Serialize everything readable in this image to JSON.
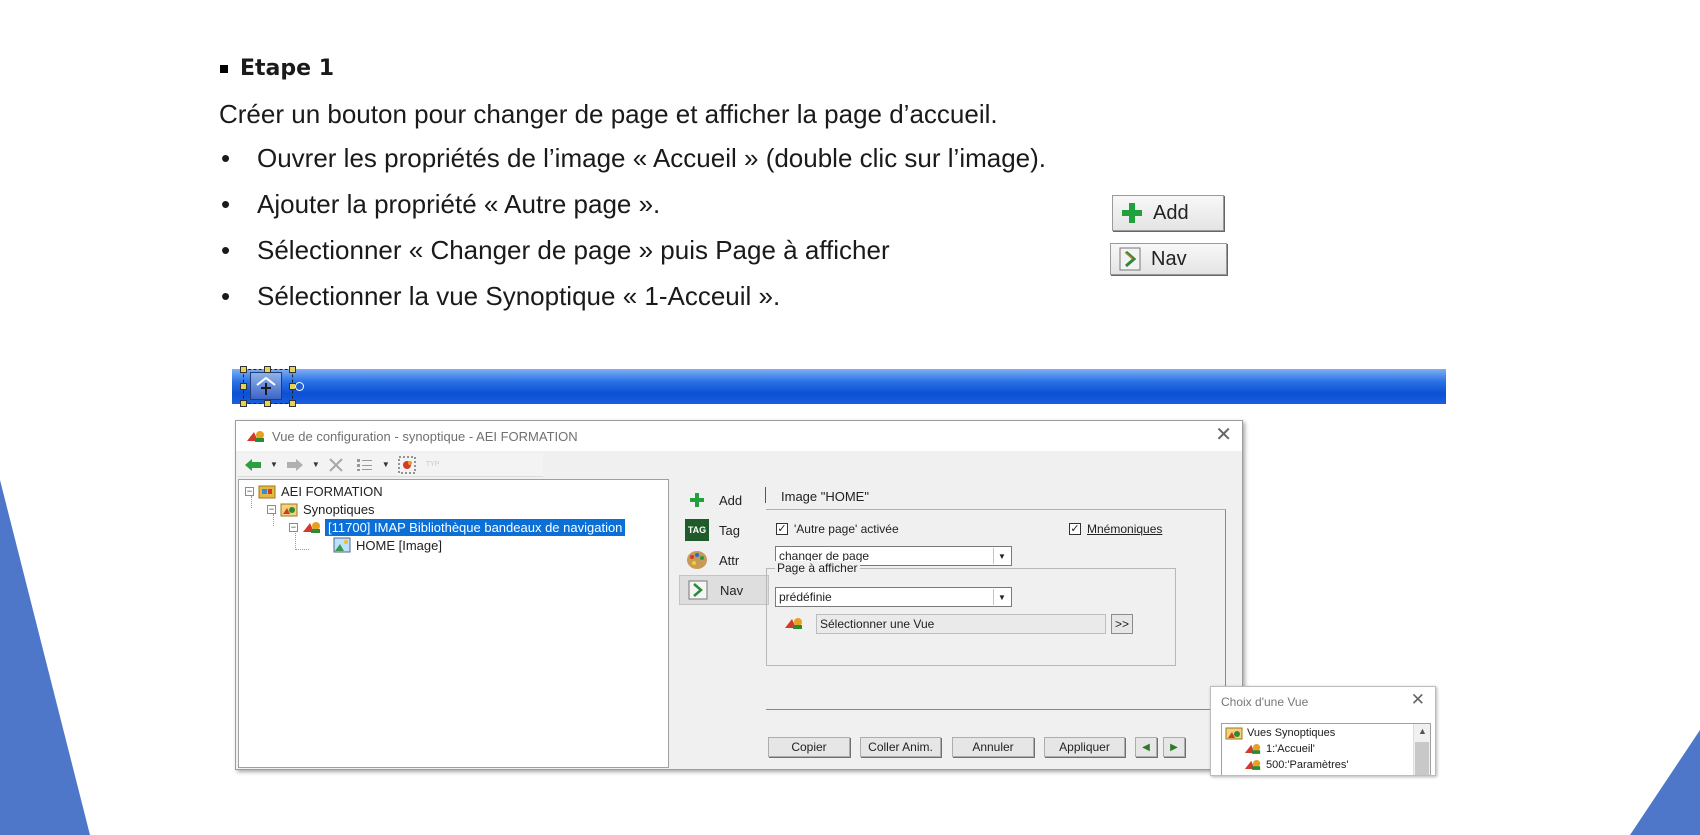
{
  "instructions": {
    "step_title": "Etape 1",
    "intro": "Créer un bouton pour changer de page et afficher la page d’accueil.",
    "bullet_glyph": "•",
    "bullets": [
      "Ouvrer les propriétés de l’image « Accueil » (double clic sur l’image).",
      "Ajouter la propriété « Autre page ».",
      "Sélectionner « Changer de page » puis Page à afficher",
      "Sélectionner la vue Synoptique « 1-Acceuil »."
    ]
  },
  "reference_buttons": {
    "add_label": "Add",
    "nav_label": "Nav"
  },
  "dialog": {
    "title": "Vue de configuration - synoptique - AEI FORMATION",
    "toolbar_faint": "TYP",
    "tree": {
      "root": "AEI FORMATION",
      "synoptiques": "Synoptiques",
      "library": "[11700]  IMAP Bibliothèque bandeaux de navigation",
      "image": "HOME [Image]"
    },
    "tabs": {
      "add": "Add",
      "tag": "Tag",
      "tag_icon_text": "TAG",
      "attr": "Attr",
      "nav": "Nav"
    },
    "properties": {
      "header": "Image  \"HOME\"",
      "autre_page_label": "'Autre page' activée",
      "autre_page_checked": true,
      "mnemoniques_label": "Mnémoniques",
      "mnemoniques_checked": true,
      "action_value": "changer de page",
      "page_group_label": "Page à afficher",
      "page_mode_value": "prédéfinie",
      "view_placeholder": "Sélectionner une Vue",
      "browse_label": ">>"
    },
    "buttons": {
      "copy": "Copier",
      "paste_anim": "Coller Anim.",
      "cancel": "Annuler",
      "apply": "Appliquer",
      "prev": "◀",
      "next": "▶"
    }
  },
  "view_chooser": {
    "title": "Choix d'une Vue",
    "root": "Vues Synoptiques",
    "items": [
      "1:'Accueil'",
      "500:'Paramètres'"
    ]
  },
  "colors": {
    "banner_blue": "#0c4fd4",
    "selection_blue": "#0a6fd6",
    "deco_blue": "#4f77c9"
  }
}
